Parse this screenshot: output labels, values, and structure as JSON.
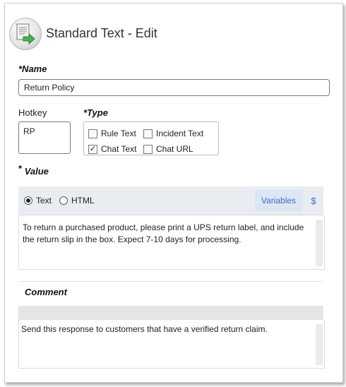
{
  "header": {
    "title": "Standard Text - Edit",
    "icon": "document-arrow-icon"
  },
  "name_field": {
    "label": "*Name",
    "value": "Return Policy"
  },
  "hotkey_field": {
    "label": "Hotkey",
    "value": "RP"
  },
  "type_field": {
    "label": "*Type",
    "options": [
      {
        "label": "Rule Text",
        "checked": false
      },
      {
        "label": "Incident Text",
        "checked": false
      },
      {
        "label": "Chat Text",
        "checked": true
      },
      {
        "label": "Chat URL",
        "checked": false
      }
    ]
  },
  "value_field": {
    "label_star": "*",
    "label": "Value",
    "format_options": [
      {
        "label": "Text",
        "selected": true
      },
      {
        "label": "HTML",
        "selected": false
      }
    ],
    "variables_label": "Variables",
    "dollar_label": "$",
    "content": "To return a purchased product, please print a UPS return label, and include the return slip in the box. Expect 7-10 days for processing."
  },
  "comment_field": {
    "label": "Comment",
    "content": "Send this response to customers that have a verified return claim."
  },
  "colors": {
    "accent": "#3a6db5",
    "toolbar": "#e9ecf0"
  }
}
